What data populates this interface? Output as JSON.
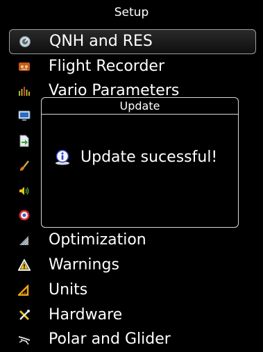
{
  "header": {
    "title": "Setup"
  },
  "menu": {
    "items": [
      {
        "label": "QNH and RES",
        "icon": "qnh-gauge-icon",
        "selected": true
      },
      {
        "label": "Flight Recorder",
        "icon": "flight-recorder-icon"
      },
      {
        "label": "Vario Parameters",
        "icon": "vario-parameters-icon"
      },
      {
        "label": "",
        "icon": "display-monitor-icon"
      },
      {
        "label": "",
        "icon": "document-arrow-icon"
      },
      {
        "label": "",
        "icon": "brush-icon"
      },
      {
        "label": "",
        "icon": "speaker-icon"
      },
      {
        "label": "",
        "icon": "target-icon"
      },
      {
        "label": "Optimization",
        "icon": "optimization-icon"
      },
      {
        "label": "Warnings",
        "icon": "warning-triangle-icon"
      },
      {
        "label": "Units",
        "icon": "ruler-triangle-icon"
      },
      {
        "label": "Hardware",
        "icon": "tools-icon"
      },
      {
        "label": "Polar and Glider",
        "icon": "glider-icon"
      }
    ]
  },
  "dialog": {
    "title": "Update",
    "message": "Update sucessful!",
    "icon": "info-icon"
  }
}
